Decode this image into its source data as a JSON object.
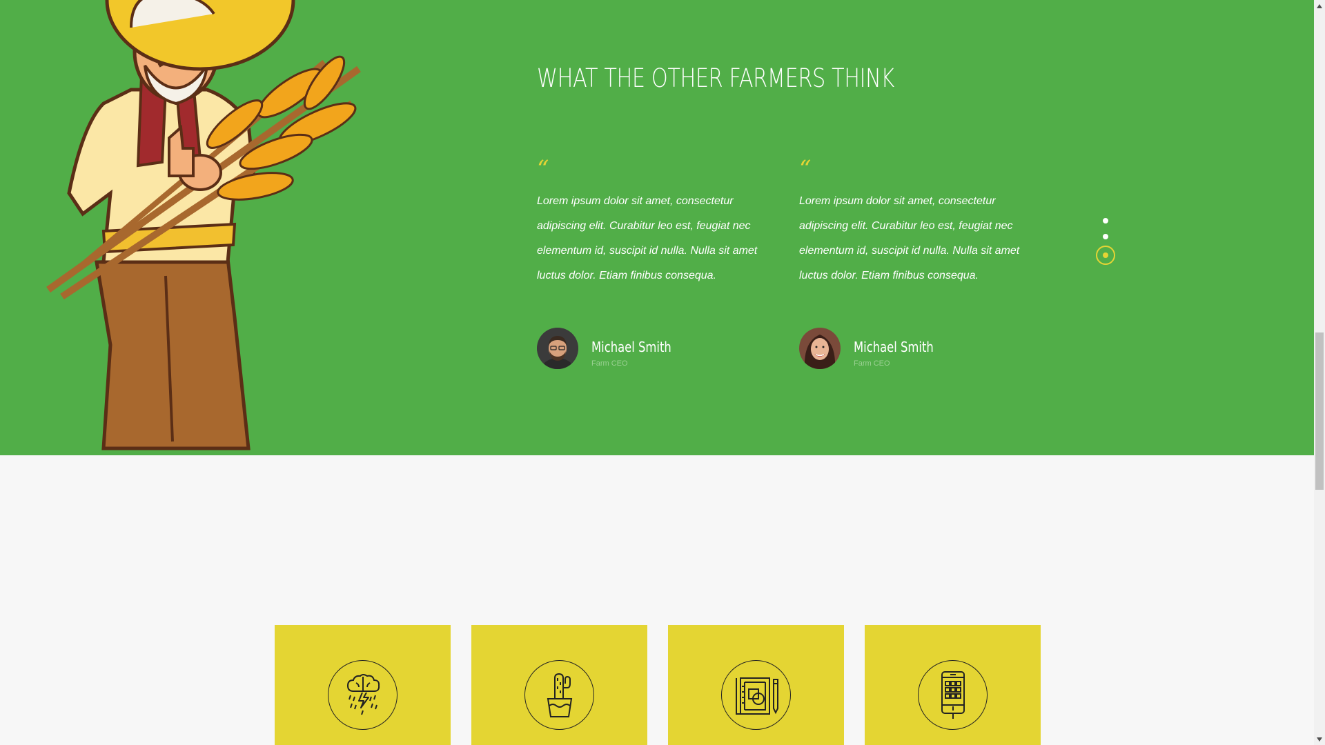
{
  "testimonials_section": {
    "heading": "WHAT THE OTHER FARMERS THINK",
    "quote_mark": "“",
    "items": [
      {
        "text": "Lorem ipsum dolor sit amet, consectetur adipiscing elit. Curabitur leo est, feugiat nec elementum id, suscipit id nulla. Nulla sit amet luctus dolor. Etiam finibus consequa.",
        "name": "Michael Smith",
        "role": "Farm CEO",
        "avatar_icon": "bearded-man-avatar"
      },
      {
        "text": "Lorem ipsum dolor sit amet, consectetur adipiscing elit. Curabitur leo est, feugiat nec elementum id, suscipit id nulla. Nulla sit amet luctus dolor. Etiam finibus consequa.",
        "name": "Michael Smith",
        "role": "Farm CEO",
        "avatar_icon": "smiling-woman-avatar"
      }
    ],
    "slider": {
      "total": 3,
      "active_index": 3
    }
  },
  "features": {
    "cards": [
      {
        "icon": "brain-storm-icon"
      },
      {
        "icon": "cactus-pot-icon"
      },
      {
        "icon": "design-notebook-icon"
      },
      {
        "icon": "mobile-app-icon"
      }
    ]
  },
  "colors": {
    "green_bg": "#51ae48",
    "accent_yellow": "#e4d435",
    "card_yellow": "#e4d533",
    "page_bg": "#f7f7f7"
  }
}
